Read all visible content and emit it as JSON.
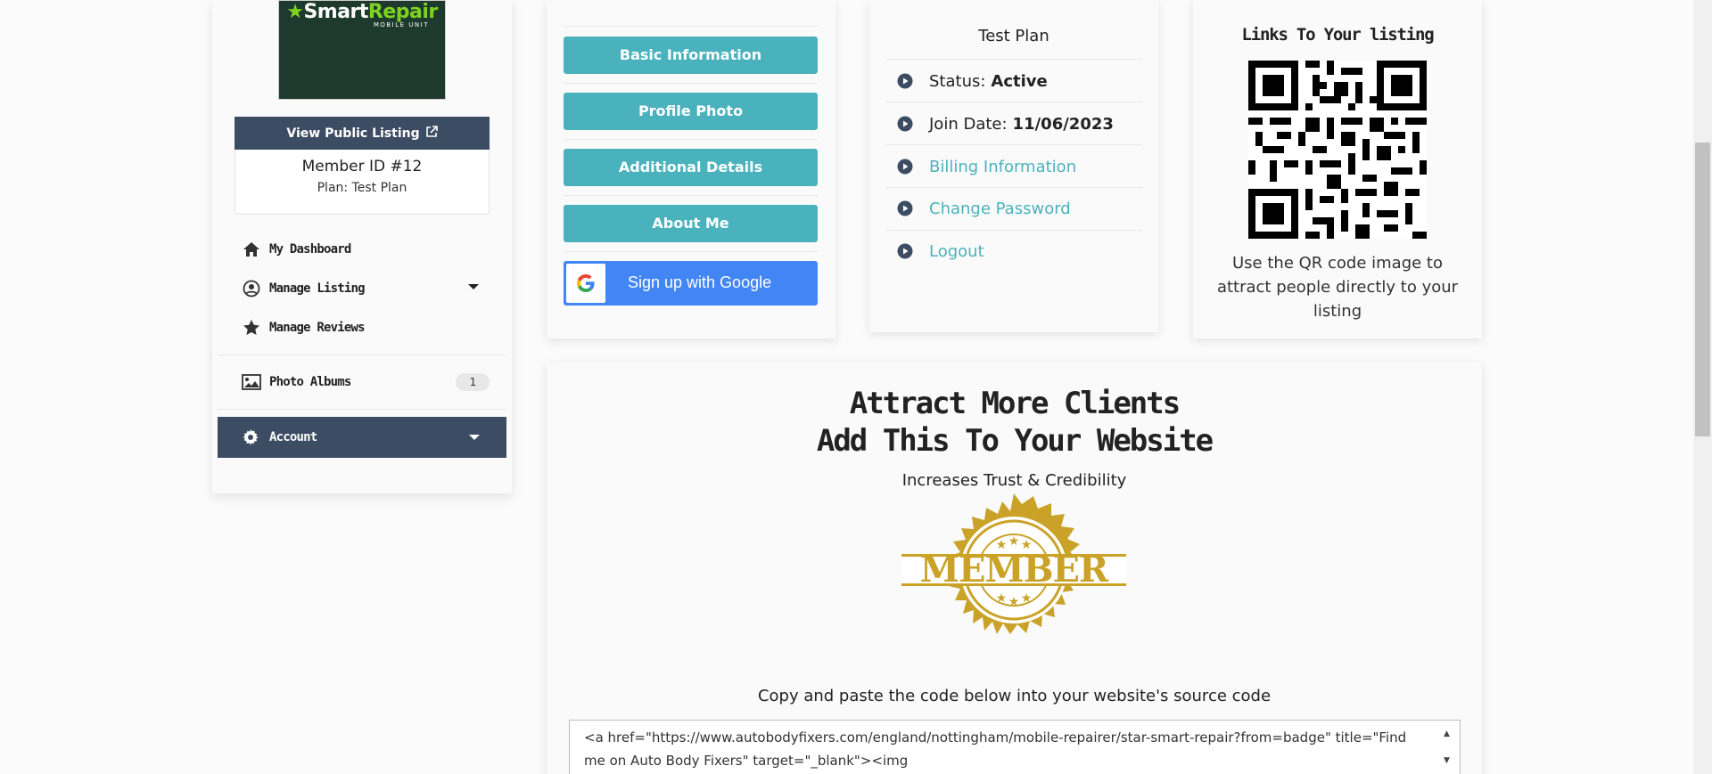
{
  "sidebar": {
    "logo": {
      "brand_part1": "Smart",
      "brand_part2": "Repair",
      "sub": "MOBILE UNIT"
    },
    "view_public_label": "View Public Listing",
    "member_id": "Member ID #12",
    "plan": "Plan: Test Plan",
    "nav": [
      {
        "label": "My Dashboard",
        "icon": "home-icon"
      },
      {
        "label": "Manage Listing",
        "icon": "user-circle-icon"
      },
      {
        "label": "Manage Reviews",
        "icon": "star-icon"
      }
    ],
    "photo_albums": {
      "label": "Photo Albums",
      "count": "1"
    },
    "account_label": "Account"
  },
  "buttons": {
    "basic_information": "Basic Information",
    "profile_photo": "Profile Photo",
    "additional_details": "Additional Details",
    "about_me": "About Me",
    "google": "Sign up with Google"
  },
  "plan_card": {
    "title": "Test Plan",
    "status_label": "Status:",
    "status_value": "Active",
    "join_label": "Join Date:",
    "join_value": "11/06/2023",
    "billing": "Billing Information",
    "change_password": "Change Password",
    "logout": "Logout"
  },
  "qr_card": {
    "title": "Links To Your listing",
    "text": "Use the QR code image to attract people directly to your listing"
  },
  "badge_card": {
    "heading_line1": "Attract More Clients",
    "heading_line2": "Add This To Your Website",
    "subheading": "Increases Trust & Credibility",
    "seal_text": "MEMBER",
    "copy_instructions": "Copy and paste the code below into your website's source code",
    "code": "<a href=\"https://www.autobodyfixers.com/england/nottingham/mobile-repairer/star-smart-repair?from=badge\" title=\"Find me on Auto Body Fixers\" target=\"_blank\"><img"
  },
  "colors": {
    "teal": "#4ab2bd",
    "navy": "#3c4c63",
    "google_blue": "#4285f4",
    "gold": "#c9a227"
  }
}
